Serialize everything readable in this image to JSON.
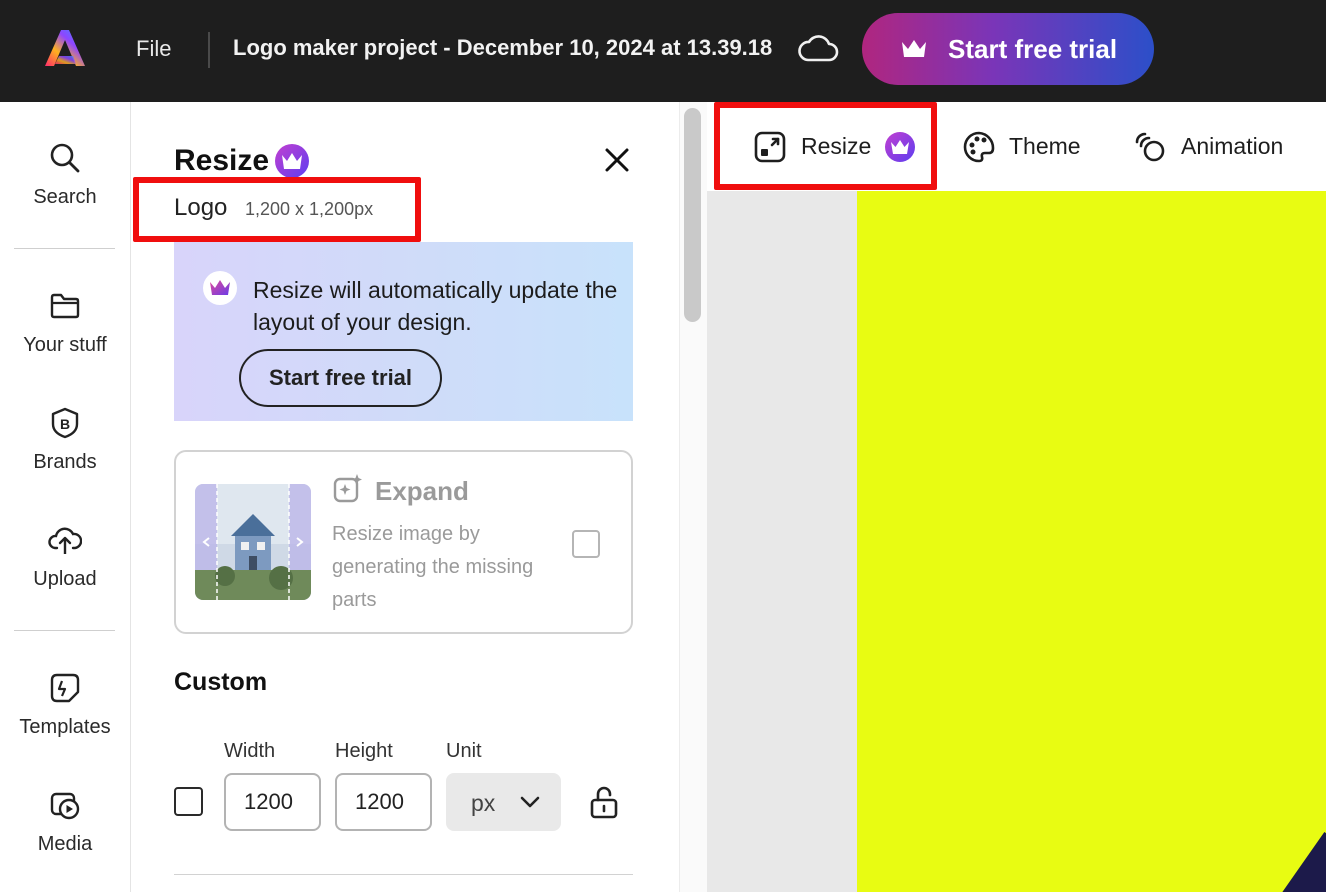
{
  "header": {
    "file_menu": "File",
    "project_title": "Logo maker project - December 10, 2024 at 13.39.18",
    "trial_button": "Start free trial",
    "icons": [
      "adobe-express-logo",
      "cloud-icon",
      "crown-icon"
    ]
  },
  "rail": {
    "items": [
      {
        "label": "Search",
        "icon": "search-icon"
      },
      {
        "label": "Your stuff",
        "icon": "folder-icon"
      },
      {
        "label": "Brands",
        "icon": "brand-icon"
      },
      {
        "label": "Upload",
        "icon": "upload-icon"
      },
      {
        "label": "Templates",
        "icon": "templates-icon"
      },
      {
        "label": "Media",
        "icon": "media-icon"
      }
    ]
  },
  "panel": {
    "title": "Resize",
    "size_name": "Logo",
    "size_dimensions": "1,200 x 1,200px",
    "promo": {
      "text": "Resize will automatically update the layout of your design.",
      "button": "Start free trial"
    },
    "expand": {
      "title": "Expand",
      "description": "Resize image by generating the missing parts",
      "checked": false
    },
    "custom": {
      "title": "Custom",
      "width_label": "Width",
      "height_label": "Height",
      "unit_label": "Unit",
      "width_value": "1200",
      "height_value": "1200",
      "unit_value": "px",
      "checked": false
    }
  },
  "toolbar": {
    "resize": "Resize",
    "theme": "Theme",
    "animation": "Animation"
  },
  "colors": {
    "highlight": "#f00e0e",
    "artboard": "#e8fc12",
    "premium": "#8a3ad6",
    "topbar": "#1e1e1e"
  }
}
